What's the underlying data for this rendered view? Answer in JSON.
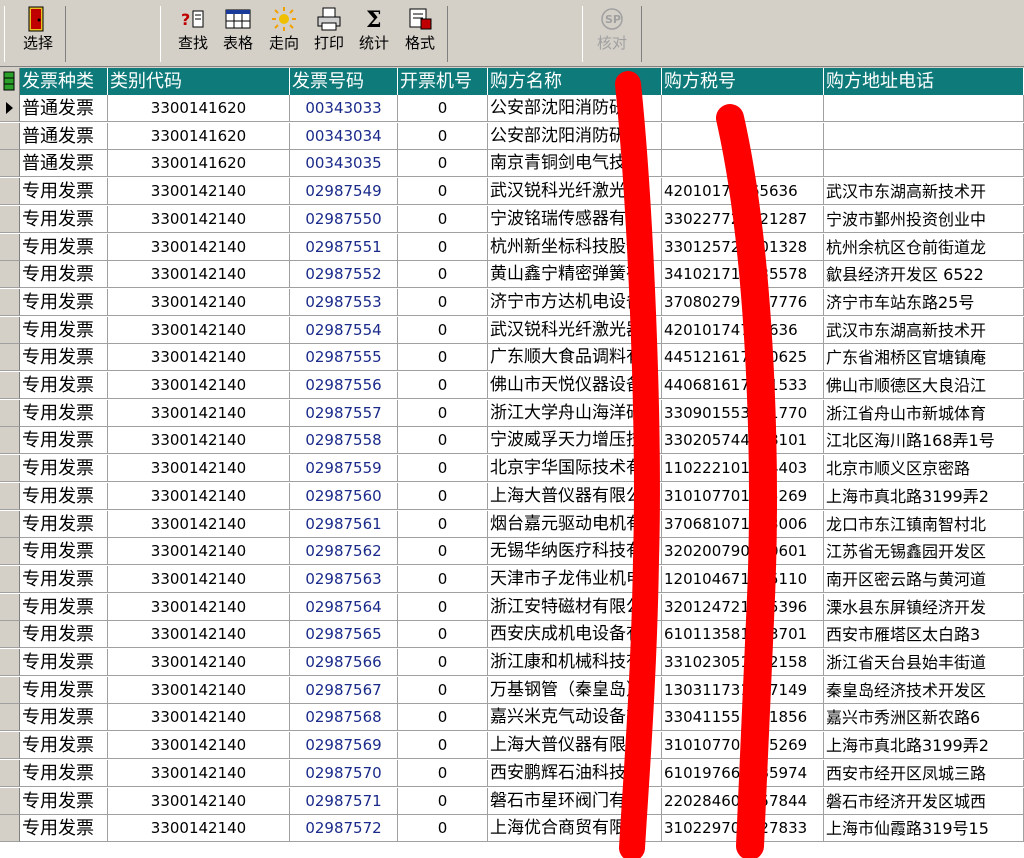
{
  "toolbar": {
    "buttons": [
      {
        "label": "选择",
        "icon": "door-exit-icon",
        "enabled": true
      },
      {
        "label": "查找",
        "icon": "find-icon",
        "enabled": true
      },
      {
        "label": "表格",
        "icon": "table-icon",
        "enabled": true
      },
      {
        "label": "走向",
        "icon": "sun-icon",
        "enabled": true
      },
      {
        "label": "打印",
        "icon": "printer-icon",
        "enabled": true
      },
      {
        "label": "统计",
        "icon": "sigma-icon",
        "enabled": true
      },
      {
        "label": "格式",
        "icon": "format-icon",
        "enabled": true
      },
      {
        "label": "核对",
        "icon": "verify-sp-icon",
        "enabled": false
      }
    ]
  },
  "grid": {
    "header_color": "#0f7a7a",
    "columns": [
      "发票种类",
      "类别代码",
      "发票号码",
      "开票机号",
      "购方名称",
      "购方税号",
      "购方地址电话"
    ],
    "rows": [
      {
        "type": "普通发票",
        "code": "3300141620",
        "number": "00343033",
        "machine": "0",
        "buyer": "公安部沈阳消防研究",
        "tax": "",
        "addr": ""
      },
      {
        "type": "普通发票",
        "code": "3300141620",
        "number": "00343034",
        "machine": "0",
        "buyer": "公安部沈阳消防研究",
        "tax": "",
        "addr": ""
      },
      {
        "type": "普通发票",
        "code": "3300141620",
        "number": "00343035",
        "machine": "0",
        "buyer": "南京青铜剑电气技术",
        "tax": "",
        "addr": ""
      },
      {
        "type": "专用发票",
        "code": "3300142140",
        "number": "02987549",
        "machine": "0",
        "buyer": "武汉锐科光纤激光器",
        "tax": "42010174765636",
        "addr": "武汉市东湖高新技术开"
      },
      {
        "type": "专用发票",
        "code": "3300142140",
        "number": "02987550",
        "machine": "0",
        "buyer": "宁波铭瑞传感器有限",
        "tax": "330227721521287",
        "addr": "宁波市鄞州投资创业中"
      },
      {
        "type": "专用发票",
        "code": "3300142140",
        "number": "02987551",
        "machine": "0",
        "buyer": "杭州新坐标科技股份",
        "tax": "330125720001328",
        "addr": "杭州余杭区仓前街道龙"
      },
      {
        "type": "专用发票",
        "code": "3300142140",
        "number": "02987552",
        "machine": "0",
        "buyer": "黄山鑫宁精密弹簧有",
        "tax": "341021713935578",
        "addr": "歙县经济开发区  6522"
      },
      {
        "type": "专用发票",
        "code": "3300142140",
        "number": "02987553",
        "machine": "0",
        "buyer": "济宁市方达机电设备",
        "tax": "370802791307776",
        "addr": "济宁市车站东路25号"
      },
      {
        "type": "专用发票",
        "code": "3300142140",
        "number": "02987554",
        "machine": "0",
        "buyer": "武汉锐科光纤激光器",
        "tax": "42010174765636",
        "addr": "武汉市东湖高新技术开"
      },
      {
        "type": "专用发票",
        "code": "3300142140",
        "number": "02987555",
        "machine": "0",
        "buyer": "广东顺大食品调料有",
        "tax": "445121617150625",
        "addr": "广东省湘桥区官塘镇庵"
      },
      {
        "type": "专用发票",
        "code": "3300142140",
        "number": "02987556",
        "machine": "0",
        "buyer": "佛山市天悦仪器设备",
        "tax": "440681617781533",
        "addr": "佛山市顺德区大良沿江"
      },
      {
        "type": "专用发票",
        "code": "3300142140",
        "number": "02987557",
        "machine": "0",
        "buyer": "浙江大学舟山海洋研",
        "tax": "330901553531770",
        "addr": "浙江省舟山市新城体育"
      },
      {
        "type": "专用发票",
        "code": "3300142140",
        "number": "02987558",
        "machine": "0",
        "buyer": "宁波威孚天力增压技",
        "tax": "330205744248101",
        "addr": "江北区海川路168弄1号"
      },
      {
        "type": "专用发票",
        "code": "3300142140",
        "number": "02987559",
        "machine": "0",
        "buyer": "北京宇华国际技术有",
        "tax": "110222101044403",
        "addr": "北京市顺义区京密路"
      },
      {
        "type": "专用发票",
        "code": "3300142140",
        "number": "02987560",
        "machine": "0",
        "buyer": "上海大普仪器有限公",
        "tax": "310107701335269",
        "addr": "上海市真北路3199弄2"
      },
      {
        "type": "专用发票",
        "code": "3300142140",
        "number": "02987561",
        "machine": "0",
        "buyer": "烟台嘉元驱动电机有",
        "tax": "370681071223006",
        "addr": "龙口市东江镇南智村北"
      },
      {
        "type": "专用发票",
        "code": "3300142140",
        "number": "02987562",
        "machine": "0",
        "buyer": "无锡华纳医疗科技有",
        "tax": "320200790340601",
        "addr": "江苏省无锡鑫园开发区"
      },
      {
        "type": "专用发票",
        "code": "3300142140",
        "number": "02987563",
        "machine": "0",
        "buyer": "天津市子龙伟业机电",
        "tax": "120104671125110",
        "addr": "南开区密云路与黄河道"
      },
      {
        "type": "专用发票",
        "code": "3300142140",
        "number": "02987564",
        "machine": "0",
        "buyer": "浙江安特磁材有限公",
        "tax": "320124721885396",
        "addr": "溧水县东屏镇经济开发"
      },
      {
        "type": "专用发票",
        "code": "3300142140",
        "number": "02987565",
        "machine": "0",
        "buyer": "西安庆成机电设备有",
        "tax": "610113581333701",
        "addr": "西安市雁塔区太白路3"
      },
      {
        "type": "专用发票",
        "code": "3300142140",
        "number": "02987566",
        "machine": "0",
        "buyer": "浙江康和机械科技有",
        "tax": "331023051142158",
        "addr": "浙江省天台县始丰街道"
      },
      {
        "type": "专用发票",
        "code": "3300142140",
        "number": "02987567",
        "machine": "0",
        "buyer": "万基钢管（秦皇岛）",
        "tax": "130311731367149",
        "addr": "秦皇岛经济技术开发区"
      },
      {
        "type": "专用发票",
        "code": "3300142140",
        "number": "02987568",
        "machine": "0",
        "buyer": "嘉兴米克气动设备有",
        "tax": "330411551161856",
        "addr": "嘉兴市秀洲区新农路6"
      },
      {
        "type": "专用发票",
        "code": "3300142140",
        "number": "02987569",
        "machine": "0",
        "buyer": "上海大普仪器有限公",
        "tax": "310107701335269",
        "addr": "上海市真北路3199弄2"
      },
      {
        "type": "专用发票",
        "code": "3300142140",
        "number": "02987570",
        "machine": "0",
        "buyer": "西安鹏辉石油科技有",
        "tax": "610197661585974",
        "addr": "西安市经开区凤城三路"
      },
      {
        "type": "专用发票",
        "code": "3300142140",
        "number": "02987571",
        "machine": "0",
        "buyer": "磐石市星环阀门有限",
        "tax": "220284601757844",
        "addr": "磐石市经济开发区城西"
      },
      {
        "type": "专用发票",
        "code": "3300142140",
        "number": "02987572",
        "machine": "0",
        "buyer": "上海优合商贸有限公",
        "tax": "310229701327833",
        "addr": "上海市仙霞路319号15"
      }
    ]
  }
}
